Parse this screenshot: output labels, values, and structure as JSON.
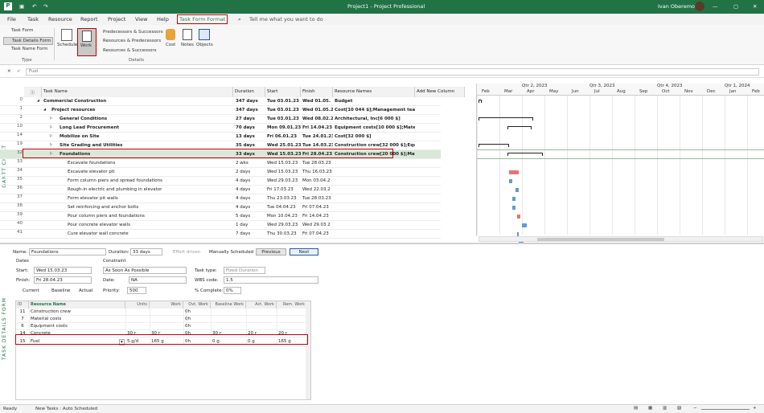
{
  "title_bar": {
    "title": "Project1 - Project Professional",
    "user": "Ivan Oberemok"
  },
  "menu": [
    "File",
    "Task",
    "Resource",
    "Report",
    "Project",
    "View",
    "Help",
    "Task Form Format"
  ],
  "search_placeholder": "Tell me what you want to do",
  "ribbon": {
    "type_group": {
      "items": [
        "Task Form",
        "Task Details Form",
        "Task Name Form"
      ],
      "label": "Type"
    },
    "details_group": {
      "schedule": "Schedule",
      "work": "Work",
      "links": [
        "Predecessors & Successors",
        "Resources & Predecessors",
        "Resources & Successors"
      ],
      "cost": "Cost",
      "notes": "Notes",
      "objects": "Objects",
      "label": "Details"
    }
  },
  "entry_value": "Fuel",
  "columns": [
    "Task Name",
    "Duration",
    "Start",
    "Finish",
    "Resource Names",
    "Add New Column"
  ],
  "rows": [
    {
      "id": "0",
      "name": "Commercial Construction",
      "dur": "347 days",
      "start": "Tue 03.01.23",
      "finish": "Wed 01.05.",
      "res": "Budget",
      "lvl": 0,
      "bold": true
    },
    {
      "id": "1",
      "name": "Project resources",
      "dur": "347 days",
      "start": "Tue 03.01.23",
      "finish": "Wed 01.05.2",
      "res": "Cost[10 044 $];Management tear",
      "lvl": 1,
      "bold": true
    },
    {
      "id": "2",
      "name": "General Conditions",
      "dur": "27 days",
      "start": "Tue 03.01.23",
      "finish": "Wed 08.02.2",
      "res": "Architectural, Inc[6 000 $]",
      "lvl": 2,
      "bold": true
    },
    {
      "id": "10",
      "name": "Long Lead Procurement",
      "dur": "70 days",
      "start": "Mon 09.01.23",
      "finish": "Fri 14.04.23",
      "res": "Equipment costs[10 000 $];Mater",
      "lvl": 2,
      "bold": true
    },
    {
      "id": "14",
      "name": "Mobilize on Site",
      "dur": "13 days",
      "start": "Fri 06.01.23",
      "finish": "Tue 24.01.23",
      "res": "Cost[32 000 $]",
      "lvl": 2,
      "bold": true
    },
    {
      "id": "19",
      "name": "Site Grading and Utilities",
      "dur": "35 days",
      "start": "Wed 25.01.23",
      "finish": "Tue 14.03.23",
      "res": "Construction crew[32 000 $];Equi",
      "lvl": 2,
      "bold": true
    },
    {
      "id": "32",
      "name": "Foundations",
      "dur": "33 days",
      "start": "Wed 15.03.23",
      "finish": "Fri 28.04.23",
      "res": "Construction crew[20 000 $];Mat",
      "lvl": 2,
      "bold": true
    },
    {
      "id": "33",
      "name": "Excavate foundations",
      "dur": "2 wks",
      "start": "Wed 15.03.23",
      "finish": "Tue 28.03.23",
      "res": "",
      "lvl": 3,
      "bold": false
    },
    {
      "id": "34",
      "name": "Excavate elevator pit",
      "dur": "2 days",
      "start": "Wed 15.03.23",
      "finish": "Thu 16.03.23",
      "res": "",
      "lvl": 3,
      "bold": false
    },
    {
      "id": "35",
      "name": "Form column piers and spread foundations",
      "dur": "4 days",
      "start": "Wed 29.03.23",
      "finish": "Mon 03.04.2",
      "res": "",
      "lvl": 3,
      "bold": false
    },
    {
      "id": "36",
      "name": "Rough-in electric and plumbing in elevator",
      "dur": "4 days",
      "start": "Fri 17.03.23",
      "finish": "Wed 22.03.2",
      "res": "",
      "lvl": 3,
      "bold": false
    },
    {
      "id": "37",
      "name": "Form elevator pit walls",
      "dur": "4 days",
      "start": "Thu 23.03.23",
      "finish": "Tue 28.03.23",
      "res": "",
      "lvl": 3,
      "bold": false
    },
    {
      "id": "38",
      "name": "Set reinforcing and anchor bolts",
      "dur": "4 days",
      "start": "Tue 04.04.23",
      "finish": "Fri 07.04.23",
      "res": "",
      "lvl": 3,
      "bold": false
    },
    {
      "id": "39",
      "name": "Pour column piers and foundations",
      "dur": "5 days",
      "start": "Mon 10.04.23",
      "finish": "Fri 14.04.23",
      "res": "",
      "lvl": 3,
      "bold": false
    },
    {
      "id": "40",
      "name": "Pour concrete elevator walls",
      "dur": "1 day",
      "start": "Wed 29.03.23",
      "finish": "Wed 29.03.2",
      "res": "",
      "lvl": 3,
      "bold": false
    },
    {
      "id": "41",
      "name": "Cure elevator wall concrete",
      "dur": "7 days",
      "start": "Thu 30.03.23",
      "finish": "Fri 07.04.23",
      "res": "",
      "lvl": 3,
      "bold": false
    }
  ],
  "gantt": {
    "quarters": [
      "Qtr 2, 2023",
      "Qtr 3, 2023",
      "Qtr 4, 2023",
      "Qtr 1, 2024"
    ],
    "months": [
      "Feb",
      "Mar",
      "Apr",
      "May",
      "Jun",
      "Jul",
      "Aug",
      "Sep",
      "Oct",
      "Nov",
      "Dec",
      "Jan",
      "Feb"
    ]
  },
  "side_labels": {
    "gantt": "GANTT CHART",
    "details": "TASK DETAILS FORM"
  },
  "form": {
    "name_label": "Name:",
    "name": "Foundations",
    "duration_label": "Duration:",
    "duration": "33 days",
    "effort": "Effort driven",
    "manual": "Manually Scheduled",
    "prev": "Previous",
    "next": "Next",
    "dates_label": "Dates",
    "start_label": "Start:",
    "start": "Wed 15.03.23",
    "finish_label": "Finish:",
    "finish": "Fri 28.04.23",
    "constraint_label": "Constraint",
    "constraint": "As Soon As Possible",
    "date_label": "Date:",
    "date": "NA",
    "task_type_label": "Task type:",
    "task_type": "Fixed Duration",
    "wbs_label": "WBS code:",
    "wbs": "1.5",
    "current": "Current",
    "baseline": "Baseline",
    "actual": "Actual",
    "priority_label": "Priority:",
    "priority": "500",
    "complete_label": "% Complete:",
    "complete": "0%"
  },
  "res_cols": [
    "ID",
    "Resource Name",
    "Units",
    "Work",
    "Ovt. Work",
    "Baseline Work",
    "Act. Work",
    "Rem. Work"
  ],
  "res_rows": [
    {
      "id": "11",
      "name": "Construction crew",
      "units": "",
      "work": "",
      "ovt": "0h",
      "base": "",
      "act": "",
      "rem": ""
    },
    {
      "id": "7",
      "name": "Material costs",
      "units": "",
      "work": "",
      "ovt": "0h",
      "base": "",
      "act": "",
      "rem": ""
    },
    {
      "id": "6",
      "name": "Equipment costs",
      "units": "",
      "work": "",
      "ovt": "0h",
      "base": "",
      "act": "",
      "rem": ""
    },
    {
      "id": "14",
      "name": "Concrete",
      "units": "30 г",
      "work": "30 г",
      "ovt": "0h",
      "base": "30 г",
      "act": "20 г",
      "rem": "20 г"
    },
    {
      "id": "15",
      "name": "Fuel",
      "units": "5 g/d",
      "work": "165 g",
      "ovt": "0h",
      "base": "0 g",
      "act": "0 g",
      "rem": "165 g"
    }
  ],
  "status": {
    "ready": "Ready",
    "mode": "New Tasks : Auto Scheduled"
  },
  "colors": {
    "accent": "#217346",
    "highlight": "#c00000"
  }
}
